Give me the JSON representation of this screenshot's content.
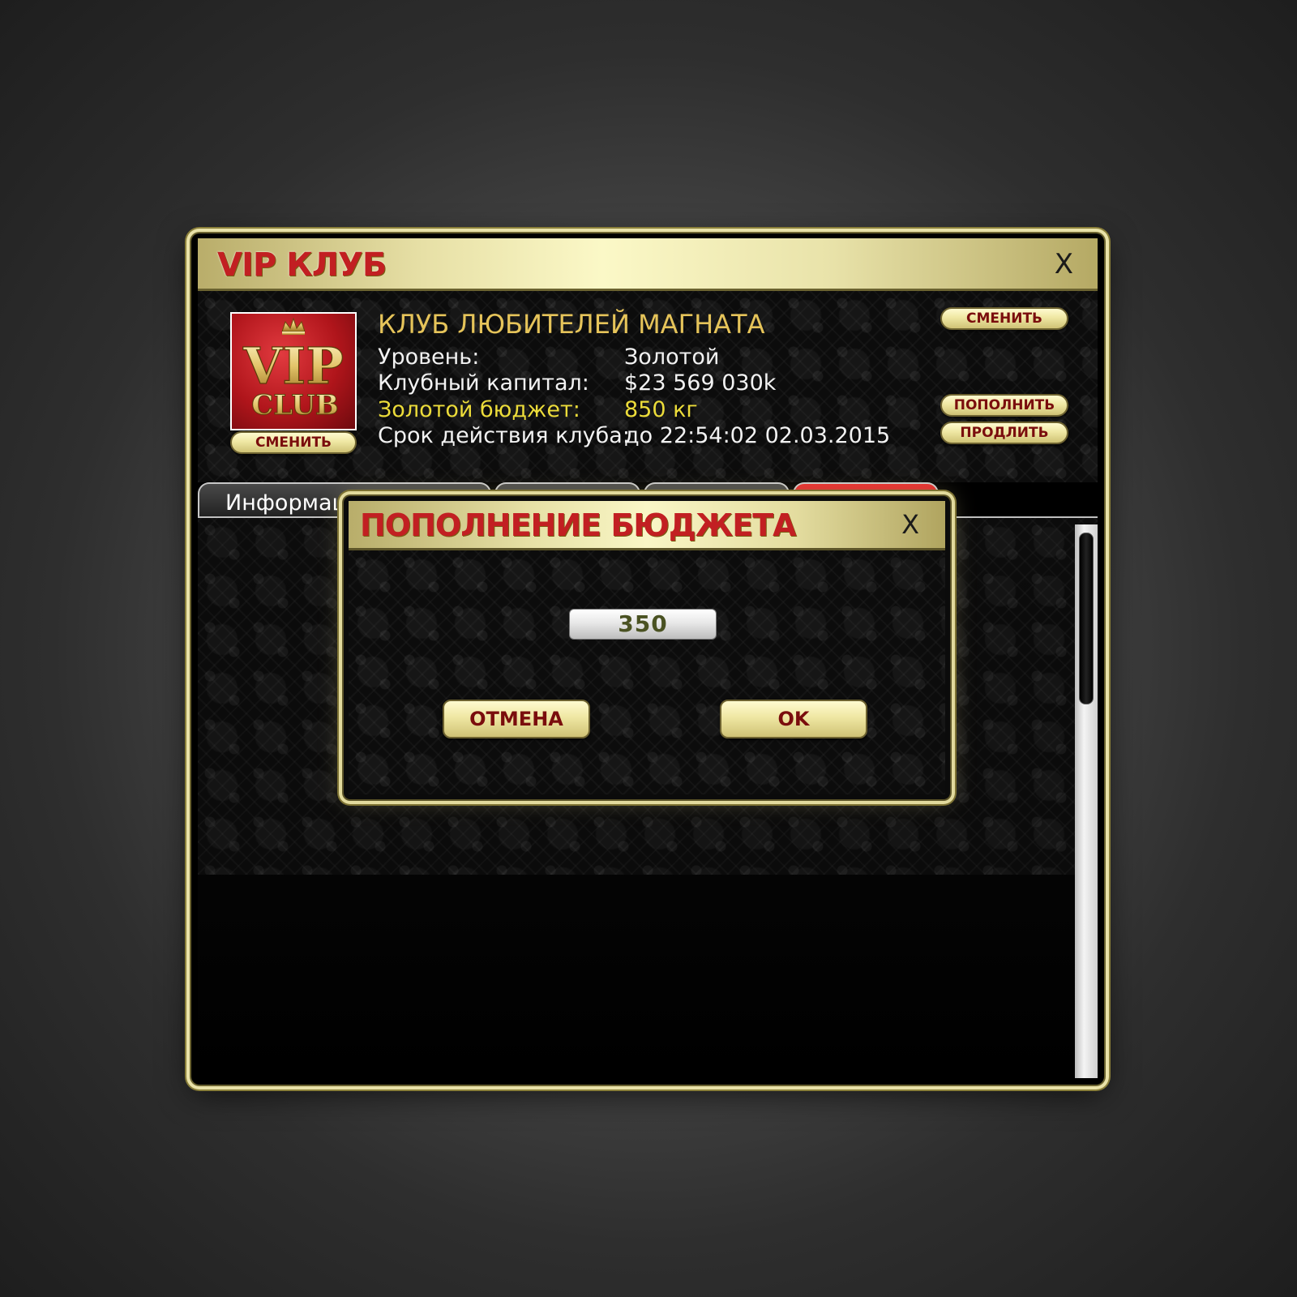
{
  "window": {
    "title": "VIP КЛУБ",
    "close_label": "X"
  },
  "club": {
    "logo_text_top": "VIP",
    "logo_text_bottom": "CLUB",
    "change_logo_label": "СМЕНИТЬ",
    "name": "КЛУБ ЛЮБИТЕЛЕЙ МАГНАТА",
    "change_name_label": "СМЕНИТЬ",
    "level_label": "Уровень:",
    "level_value": "Золотой",
    "capital_label": "Клубный капитал:",
    "capital_value": "$23 569 030k",
    "budget_label": "Золотой бюджет:",
    "budget_value": "850 кг",
    "expiry_label": "Срок действия клуба:",
    "expiry_value": "до 22:54:02 02.03.2015",
    "topup_label": "ПОПОЛНИТЬ",
    "extend_label": "ПРОДЛИТЬ"
  },
  "tabs": [
    {
      "label": "Информация"
    },
    {
      "label": ""
    },
    {
      "label": ""
    },
    {
      "label": ""
    }
  ],
  "modal": {
    "title": "ПОПОЛНЕНИЕ БЮДЖЕТА",
    "close_label": "X",
    "amount_value": "350",
    "cancel_label": "ОТМЕНА",
    "ok_label": "OK"
  },
  "colors": {
    "title_red": "#c21f22",
    "gold_text": "#e6c45a",
    "budget_yellow": "#ecdc3a",
    "button_text": "#7a0d0d"
  }
}
